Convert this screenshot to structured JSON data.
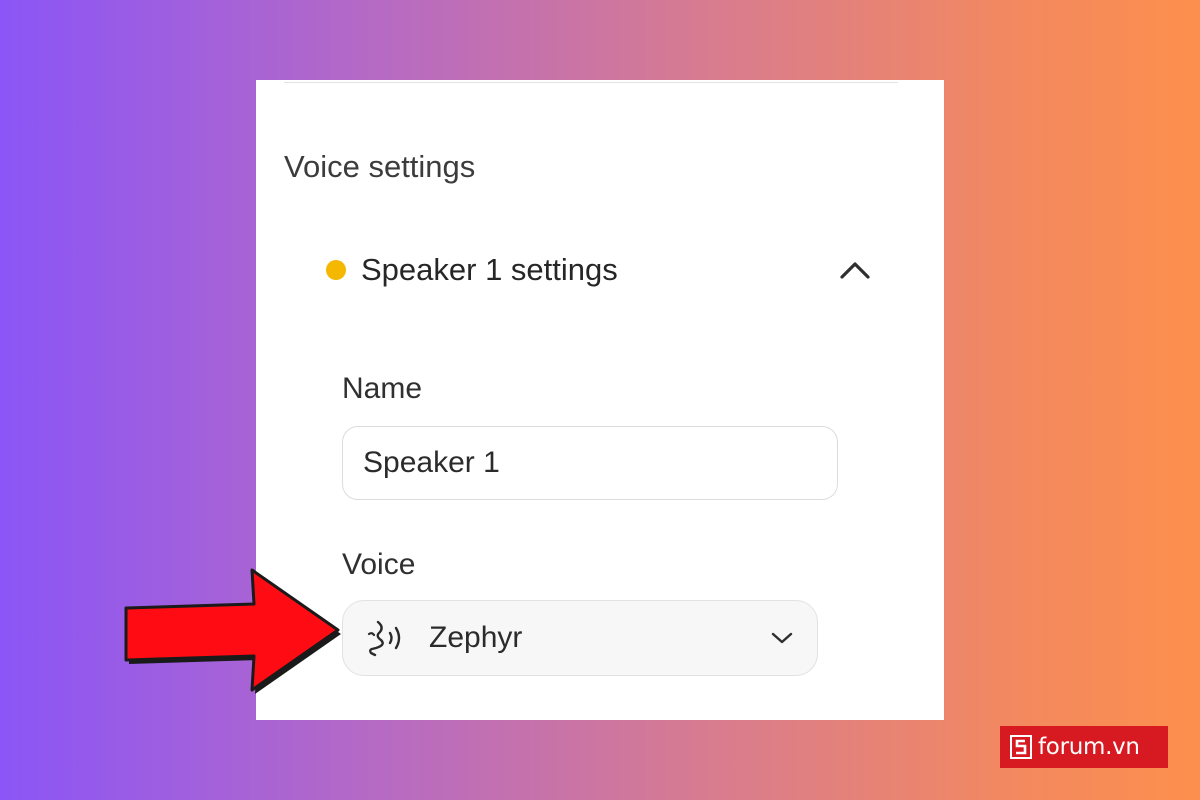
{
  "panel": {
    "section_title": "Voice settings",
    "speaker": {
      "title": "Speaker 1 settings",
      "dot_color": "#f5b800",
      "expanded": true,
      "toggle_icon": "chevron-up-icon"
    },
    "name_field": {
      "label": "Name",
      "value": "Speaker 1"
    },
    "voice_field": {
      "label": "Voice",
      "value": "Zephyr",
      "icon": "voice-speaking-icon",
      "dropdown_icon": "chevron-down-icon"
    }
  },
  "annotation": {
    "arrow_color": "#ff0b13"
  },
  "watermark": {
    "text": "forum.vn",
    "logo_letter": "S",
    "background": "#d71921"
  }
}
